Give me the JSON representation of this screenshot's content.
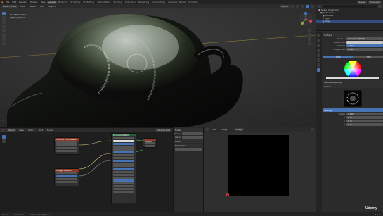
{
  "app": {
    "menu": [
      "File",
      "Edit",
      "Render",
      "Window",
      "Help"
    ],
    "workspaces": [
      "Layout",
      "Modeling",
      "Sculpting",
      "UV Editing",
      "Texture Paint",
      "Shading",
      "Animation",
      "Rendering",
      "Compositing",
      "Geometry Nodes",
      "Scripting"
    ],
    "active_workspace": "Layout",
    "scene": "Scene",
    "view_layer": "ViewLayer"
  },
  "viewport": {
    "mode": "Object Mode",
    "header_items": [
      "View",
      "Select",
      "Add",
      "Object"
    ],
    "transform": "Global",
    "overlay_title": "User Perspective",
    "overlay_subtitle": "(1) Mug Object",
    "colors": {
      "background": "#2a2a2a",
      "mesh": "#0a0a0a",
      "highlight": "#cfe3d5"
    }
  },
  "outliner": {
    "rows": [
      {
        "label": "Scene Collection",
        "selected": false
      },
      {
        "label": "Collection",
        "selected": false
      },
      {
        "label": "Camera",
        "selected": false
      },
      {
        "label": "Light",
        "selected": false
      },
      {
        "label": "Mug",
        "selected": true
      }
    ]
  },
  "properties": {
    "title": "Surface",
    "rows": [
      {
        "label": "Surface",
        "value": "Principled BSDF"
      },
      {
        "label": "Base Color",
        "value": ""
      },
      {
        "label": "Metallic",
        "value": "1.000"
      },
      {
        "label": "Roughness",
        "value": "0.100"
      }
    ],
    "color_tabs": [
      "RGB",
      "HSV"
    ],
    "sections": [
      "Texture Mapping",
      "Vector",
      "Settings"
    ],
    "settings_rows": [
      {
        "label": "Scale",
        "value": "1.000"
      },
      {
        "label": "X",
        "value": "0 m"
      },
      {
        "label": "Y",
        "value": "0 m"
      },
      {
        "label": "Z",
        "value": "0 m"
      }
    ]
  },
  "node_editor": {
    "header_items": [
      "Object",
      "View",
      "Select",
      "Add",
      "Node"
    ],
    "material": "Material.001",
    "nodes": [
      {
        "title": "Principled BSDF",
        "color": "#1f5f3a"
      },
      {
        "title": "Texture Coordinate",
        "color": "#8a3a2a"
      },
      {
        "title": "Image Texture",
        "color": "#8a3a2a"
      },
      {
        "title": "Material Output",
        "color": "#8a3a2a"
      }
    ],
    "sidebar": {
      "title": "Node",
      "fields": [
        "Name",
        "Label",
        "Color",
        "Properties"
      ]
    }
  },
  "image_editor": {
    "header_items": [
      "View",
      "Image"
    ],
    "image_name": "Image",
    "colors": {
      "canvas": "#000000"
    }
  },
  "statusbar": {
    "items": [
      "Select",
      "Pan View",
      "Node Context Menu"
    ],
    "version": "4.0.1"
  },
  "watermark": "Udemy"
}
